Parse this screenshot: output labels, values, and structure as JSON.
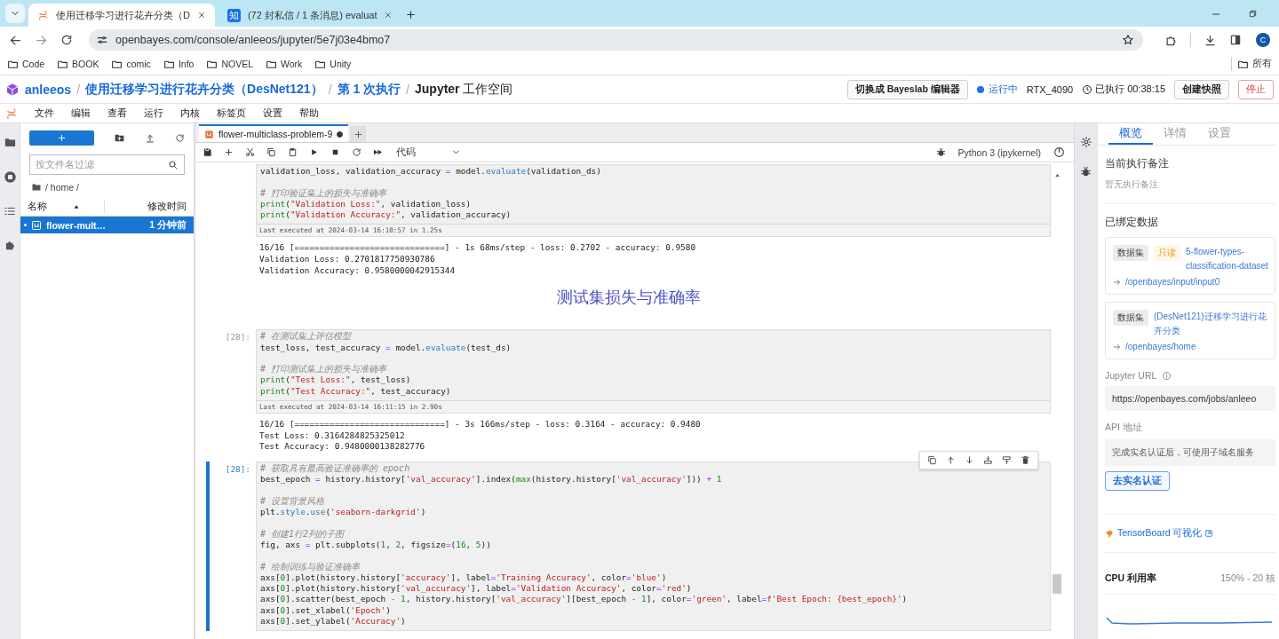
{
  "browser": {
    "tabs": [
      {
        "title": "使用迁移学习进行花卉分类（D",
        "selected": true
      },
      {
        "title": "(72 封私信 / 1 条消息) evaluat",
        "favicon": "知",
        "selected": false
      }
    ],
    "url": "openbayes.com/console/anleeos/jupyter/5e7j03e4bmo7",
    "avatar": "C",
    "bookmarks": [
      "Code",
      "BOOK",
      "comic",
      "Info",
      "NOVEL",
      "Work",
      "Unity"
    ],
    "bookmarks_more": "所有"
  },
  "header": {
    "separator": "/",
    "crumbs": [
      "anleeos",
      "使用迁移学习进行花卉分类（DesNet121）",
      "第 1 次执行",
      "**Jupyter** 工作空间"
    ],
    "editor_button": "切换成 Bayeslab 编辑器",
    "status": "运行中",
    "running": true,
    "gpu": "RTX_4090",
    "elapsed": "已执行 00:38:15",
    "snapshot_button": "创建快照",
    "stop_button": "停止"
  },
  "menu": [
    "文件",
    "编辑",
    "查看",
    "运行",
    "内核",
    "标签页",
    "设置",
    "帮助"
  ],
  "file_browser": {
    "filter_placeholder": "按文件名过滤",
    "path": "/ home /",
    "columns": [
      "名称",
      "修改时间"
    ],
    "files": [
      {
        "name": "flower-mult…",
        "modified": "1 分钟前",
        "selected": true,
        "running": true
      }
    ]
  },
  "notebook": {
    "tab": {
      "title": "flower-multiclass-problem-9",
      "unsaved": true
    },
    "cell_type": "代码",
    "kernel": "Python 3 (ipykernel)",
    "cells": [
      {
        "kind": "code",
        "active": false,
        "code": [
          [
            [
              {
                "kind": "plain",
                "text": "validation_loss, validation_accuracy "
              },
              {
                "kind": "op",
                "text": "="
              },
              {
                "kind": "plain",
                "text": " model."
              },
              {
                "kind": "method",
                "text": "evaluate"
              },
              {
                "kind": "plain",
                "text": "(validation_ds)"
              }
            ]
          ],
          [
            [
              {
                "kind": "comment",
                "text": "# 打印验证集上的损失与准确率"
              }
            ],
            [
              {
                "kind": "builtin",
                "text": "print"
              },
              {
                "kind": "plain",
                "text": "("
              },
              {
                "kind": "string",
                "text": "\"Validation Loss:\""
              },
              {
                "kind": "plain",
                "text": ", validation_loss)"
              }
            ],
            [
              {
                "kind": "builtin",
                "text": "print"
              },
              {
                "kind": "plain",
                "text": "("
              },
              {
                "kind": "string",
                "text": "\"Validation Accuracy:\""
              },
              {
                "kind": "plain",
                "text": ", validation_accuracy)"
              }
            ]
          ]
        ],
        "executed": "Last executed at 2024-03-14 16:10:57 in 1.25s",
        "output": [
          "16/16 [==============================] - 1s 68ms/step - loss: 0.2702 - accuracy: 0.9580",
          "Validation Loss: 0.2701817750930786",
          "Validation Accuracy: 0.9580000042915344"
        ]
      },
      {
        "kind": "markdown",
        "heading": "测试集损失与准确率"
      },
      {
        "kind": "code",
        "prompt": "[28]:",
        "active": false,
        "code": [
          [
            [
              {
                "kind": "comment",
                "text": "# 在测试集上评估模型"
              }
            ],
            [
              {
                "kind": "plain",
                "text": "test_loss, test_accuracy "
              },
              {
                "kind": "op",
                "text": "="
              },
              {
                "kind": "plain",
                "text": " model."
              },
              {
                "kind": "method",
                "text": "evaluate"
              },
              {
                "kind": "plain",
                "text": "(test_ds)"
              }
            ]
          ],
          [
            [
              {
                "kind": "comment",
                "text": "# 打印测试集上的损失与准确率"
              }
            ],
            [
              {
                "kind": "builtin",
                "text": "print"
              },
              {
                "kind": "plain",
                "text": "("
              },
              {
                "kind": "string",
                "text": "\"Test Loss:\""
              },
              {
                "kind": "plain",
                "text": ", test_loss)"
              }
            ],
            [
              {
                "kind": "builtin",
                "text": "print"
              },
              {
                "kind": "plain",
                "text": "("
              },
              {
                "kind": "string",
                "text": "\"Test Accuracy:\""
              },
              {
                "kind": "plain",
                "text": ", test_accuracy)"
              }
            ]
          ]
        ],
        "executed": "Last executed at 2024-03-14 16:11:15 in 2.90s",
        "output": [
          "16/16 [==============================] - 3s 166ms/step - loss: 0.3164 - accuracy: 0.9480",
          "Test Loss: 0.3164284825325012",
          "Test Accuracy: 0.9480000138282776"
        ]
      },
      {
        "kind": "code",
        "prompt": "[28]:",
        "active": true,
        "code": [
          [
            [
              {
                "kind": "comment",
                "text": "# 获取具有最高验证准确率的 epoch"
              }
            ],
            [
              {
                "kind": "plain",
                "text": "best_epoch "
              },
              {
                "kind": "op",
                "text": "="
              },
              {
                "kind": "plain",
                "text": " history.history["
              },
              {
                "kind": "string",
                "text": "'val_accuracy'"
              },
              {
                "kind": "plain",
                "text": "].index("
              },
              {
                "kind": "builtin",
                "text": "max"
              },
              {
                "kind": "plain",
                "text": "(history.history["
              },
              {
                "kind": "string",
                "text": "'val_accuracy'"
              },
              {
                "kind": "plain",
                "text": "])) "
              },
              {
                "kind": "op",
                "text": "+"
              },
              {
                "kind": "number",
                "text": " 1"
              }
            ]
          ],
          [
            [
              {
                "kind": "comment",
                "text": "# 设置背景风格"
              }
            ],
            [
              {
                "kind": "plain",
                "text": "plt."
              },
              {
                "kind": "method",
                "text": "style"
              },
              {
                "kind": "plain",
                "text": "."
              },
              {
                "kind": "method",
                "text": "use"
              },
              {
                "kind": "plain",
                "text": "("
              },
              {
                "kind": "string",
                "text": "'seaborn-darkgrid'"
              },
              {
                "kind": "plain",
                "text": ")"
              }
            ]
          ],
          [
            [
              {
                "kind": "comment",
                "text": "# 创建1行2列的子图"
              }
            ],
            [
              {
                "kind": "plain",
                "text": "fig, axs "
              },
              {
                "kind": "op",
                "text": "="
              },
              {
                "kind": "plain",
                "text": " plt.subplots("
              },
              {
                "kind": "number",
                "text": "1"
              },
              {
                "kind": "plain",
                "text": ", "
              },
              {
                "kind": "number",
                "text": "2"
              },
              {
                "kind": "plain",
                "text": ", figsize"
              },
              {
                "kind": "op",
                "text": "="
              },
              {
                "kind": "plain",
                "text": "("
              },
              {
                "kind": "number",
                "text": "16"
              },
              {
                "kind": "plain",
                "text": ", "
              },
              {
                "kind": "number",
                "text": "5"
              },
              {
                "kind": "plain",
                "text": "))"
              }
            ]
          ],
          [
            [
              {
                "kind": "comment",
                "text": "# 绘制训练与验证准确率"
              }
            ],
            [
              {
                "kind": "plain",
                "text": "axs["
              },
              {
                "kind": "number",
                "text": "0"
              },
              {
                "kind": "plain",
                "text": "].plot(history.history["
              },
              {
                "kind": "string",
                "text": "'accuracy'"
              },
              {
                "kind": "plain",
                "text": "], label"
              },
              {
                "kind": "op",
                "text": "="
              },
              {
                "kind": "string",
                "text": "'Training Accuracy'"
              },
              {
                "kind": "plain",
                "text": ", color"
              },
              {
                "kind": "op",
                "text": "="
              },
              {
                "kind": "string",
                "text": "'blue'"
              },
              {
                "kind": "plain",
                "text": ")"
              }
            ],
            [
              {
                "kind": "plain",
                "text": "axs["
              },
              {
                "kind": "number",
                "text": "0"
              },
              {
                "kind": "plain",
                "text": "].plot(history.history["
              },
              {
                "kind": "string",
                "text": "'val_accuracy'"
              },
              {
                "kind": "plain",
                "text": "], label"
              },
              {
                "kind": "op",
                "text": "="
              },
              {
                "kind": "string",
                "text": "'Validation Accuracy'"
              },
              {
                "kind": "plain",
                "text": ", color"
              },
              {
                "kind": "op",
                "text": "="
              },
              {
                "kind": "string",
                "text": "'red'"
              },
              {
                "kind": "plain",
                "text": ")"
              }
            ],
            [
              {
                "kind": "plain",
                "text": "axs["
              },
              {
                "kind": "number",
                "text": "0"
              },
              {
                "kind": "plain",
                "text": "].scatter(best_epoch "
              },
              {
                "kind": "op",
                "text": "-"
              },
              {
                "kind": "number",
                "text": " 1"
              },
              {
                "kind": "plain",
                "text": ", history.history["
              },
              {
                "kind": "string",
                "text": "'val_accuracy'"
              },
              {
                "kind": "plain",
                "text": "][best_epoch "
              },
              {
                "kind": "op",
                "text": "-"
              },
              {
                "kind": "number",
                "text": " 1"
              },
              {
                "kind": "plain",
                "text": "], color"
              },
              {
                "kind": "op",
                "text": "="
              },
              {
                "kind": "string",
                "text": "'green'"
              },
              {
                "kind": "plain",
                "text": ", label"
              },
              {
                "kind": "op",
                "text": "="
              },
              {
                "kind": "string",
                "text": "f'Best Epoch: {best_epoch}'"
              },
              {
                "kind": "plain",
                "text": ")"
              }
            ],
            [
              {
                "kind": "plain",
                "text": "axs["
              },
              {
                "kind": "number",
                "text": "0"
              },
              {
                "kind": "plain",
                "text": "].set_xlabel("
              },
              {
                "kind": "string",
                "text": "'Epoch'"
              },
              {
                "kind": "plain",
                "text": ")"
              }
            ],
            [
              {
                "kind": "plain",
                "text": "axs["
              },
              {
                "kind": "number",
                "text": "0"
              },
              {
                "kind": "plain",
                "text": "].set_ylabel("
              },
              {
                "kind": "string",
                "text": "'Accuracy'"
              },
              {
                "kind": "plain",
                "text": ")"
              }
            ]
          ]
        ]
      }
    ]
  },
  "info_panel": {
    "tabs": [
      {
        "label": "概览",
        "selected": true
      },
      {
        "label": "详情",
        "selected": false
      },
      {
        "label": "设置",
        "selected": false
      }
    ],
    "note_title": "当前执行备注",
    "note": "暂无执行备注",
    "bound_title": "已绑定数据",
    "datasets": [
      {
        "tags": [
          {
            "text": "数据集",
            "kind": "type"
          },
          {
            "text": "只读",
            "kind": "readonly"
          }
        ],
        "name": "5-flower-types-classification-dataset",
        "mount": "/openbayes/input/input0"
      },
      {
        "tags": [
          {
            "text": "数据集",
            "kind": "type"
          }
        ],
        "name": "(DesNet121)迁移学习进行花卉分类",
        "mount": "/openbayes/home"
      }
    ],
    "jupyter_url_label": "Jupyter URL",
    "jupyter_url": "https://openbayes.com/jobs/anleeo",
    "api_label": "API 地址",
    "api_value": "完成实名认证后，可使用子域名服务",
    "verify_button": "去实名认证",
    "tensorboard": "TensorBoard 可视化",
    "cpu_label": "CPU 利用率",
    "cpu_value": "150% - 20 核"
  }
}
